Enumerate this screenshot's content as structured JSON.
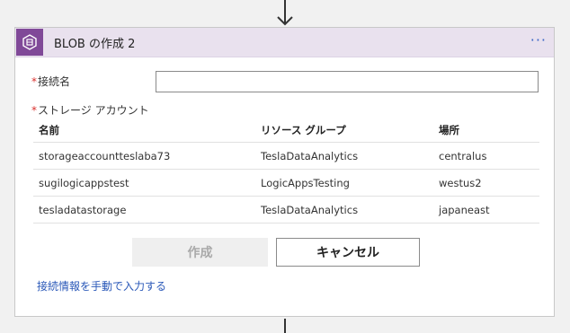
{
  "card": {
    "title": "BLOB の作成 2",
    "more_label": "···"
  },
  "form": {
    "connection_name": {
      "required_mark": "*",
      "label": "接続名",
      "value": "",
      "placeholder": ""
    },
    "storage_account": {
      "required_mark": "*",
      "label": "ストレージ アカウント"
    }
  },
  "table": {
    "columns": [
      "名前",
      "リソース グループ",
      "場所"
    ],
    "rows": [
      {
        "name": "storageaccountteslaba73",
        "resource_group": "TeslaDataAnalytics",
        "location": "centralus"
      },
      {
        "name": "sugilogicappstest",
        "resource_group": "LogicAppsTesting",
        "location": "westus2"
      },
      {
        "name": "tesladatastorage",
        "resource_group": "TeslaDataAnalytics",
        "location": "japaneast"
      }
    ]
  },
  "buttons": {
    "create_label": "作成",
    "cancel_label": "キャンセル"
  },
  "links": {
    "manual_entry": "接続情報を手動で入力する"
  },
  "colors": {
    "header_bg": "#e9e1ee",
    "icon_bg": "#804998",
    "link": "#2a58b8",
    "required": "#d9302c"
  },
  "icons": {
    "app": "storage-blob-icon",
    "connector_arrow": "arrow-down-icon"
  }
}
